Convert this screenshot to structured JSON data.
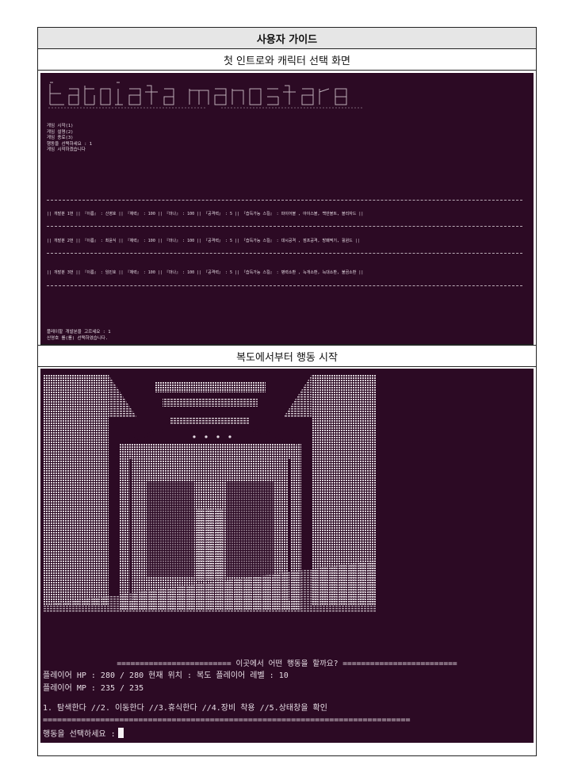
{
  "guide": {
    "title": "사용자 가이드",
    "section1_title": "첫 인트로와 캐릭터 선택 화면",
    "section2_title": "복도에서부터 행동 시작"
  },
  "intro": {
    "menu": [
      "게임 시작(1)",
      "게임 설명(2)",
      "게임 종료(3)",
      "행동을 선택하세요 : 1",
      "게임 시작하겠습니다"
    ],
    "developers": [
      {
        "line": "||  개발분 1번  ||  『이름』 : 신영호  ||  『체력』 : 100  ||  『마나』 : 100  ||  『공격력』 : 5  ||  『습득가능 스킬』 : 파이어볼 , 아이스볼, 백만볼트, 블리자드  ||"
      },
      {
        "line": "||  개발분 2번  ||  『이름』 : 최윤식  ||  『체력』 : 100  ||  『마나』 : 100  ||  『공격력』 : 5  ||  『습득가능 스킬』 : 대시공격 , 점프공격, 방패찍기, 휠윈드  ||"
      },
      {
        "line": "||  개발분 3번  ||  『이름』 : 임민호  ||  『체력』 : 100  ||  『마나』 : 100  ||  『공격력』 : 5  ||  『습득가능 스킬』 : 병력소환 , 늑개소환, 늑대소환, 불곰소환  ||"
      }
    ],
    "prompt": [
      "플레이할 개발분을 고르세요 : 1",
      "신영호 를(를) 선택하였습니다."
    ]
  },
  "game": {
    "question": "========================= 이곳에서 어떤 행동을 할까요? =========================",
    "hp_line": "플레이어 HP : 280 / 280       현재 위치 : 복도          플레이어 레벨 : 10",
    "mp_line": "플레이어 MP : 235 / 235",
    "actions_line": "1. 탐색한다 //2. 이동한다 //3.휴식한다 //4.장비 착용 //5.상태창을 확인",
    "divider": "=============================================================================",
    "input_prompt": "행동을 선택하세요 :"
  },
  "colors": {
    "terminal_bg": "#2c0a24",
    "terminal_text": "#e6dce4",
    "header_bg": "#e6e6e6"
  }
}
